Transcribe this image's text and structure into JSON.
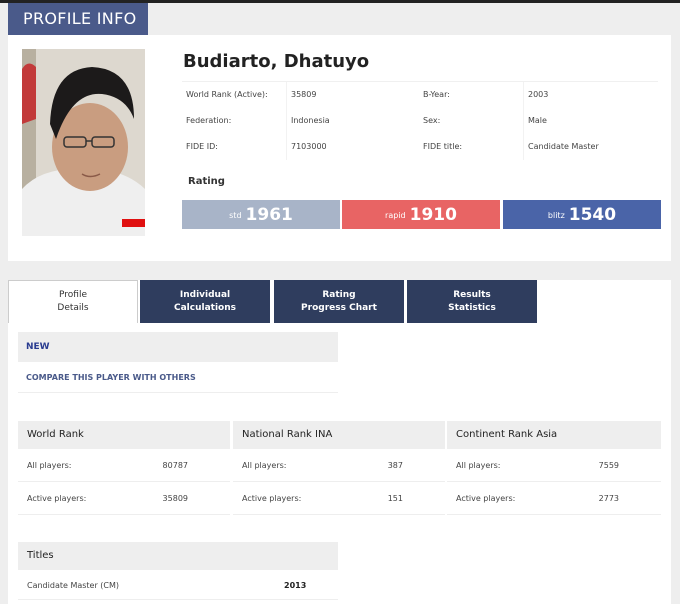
{
  "header": {
    "title": "PROFILE INFO"
  },
  "profile": {
    "name": "Budiarto, Dhatuyo",
    "fields": [
      {
        "label": "World Rank (Active):",
        "value": "35809",
        "label2": "B-Year:",
        "value2": "2003"
      },
      {
        "label": "Federation:",
        "value": "Indonesia",
        "label2": "Sex:",
        "value2": "Male"
      },
      {
        "label": "FIDE ID:",
        "value": "7103000",
        "label2": "FIDE title:",
        "value2": "Candidate Master"
      }
    ],
    "rating_label": "Rating",
    "ratings": {
      "std": {
        "type": "std",
        "value": "1961",
        "color": "#a8b4c8"
      },
      "rapid": {
        "type": "rapid",
        "value": "1910",
        "color": "#e86464"
      },
      "blitz": {
        "type": "blitz",
        "value": "1540",
        "color": "#4a64a8"
      }
    }
  },
  "tabs": [
    {
      "line1": "Profile",
      "line2": "Details"
    },
    {
      "line1": "Individual",
      "line2": "Calculations"
    },
    {
      "line1": "Rating",
      "line2": "Progress Chart"
    },
    {
      "line1": "Results",
      "line2": "Statistics"
    }
  ],
  "new_block": {
    "label": "NEW",
    "compare_link": "COMPARE THIS PLAYER WITH OTHERS"
  },
  "ranks": [
    {
      "title": "World Rank",
      "all_label": "All players:",
      "all_value": "80787",
      "active_label": "Active players:",
      "active_value": "35809"
    },
    {
      "title": "National Rank INA",
      "all_label": "All players:",
      "all_value": "387",
      "active_label": "Active players:",
      "active_value": "151"
    },
    {
      "title": "Continent Rank Asia",
      "all_label": "All players:",
      "all_value": "7559",
      "active_label": "Active players:",
      "active_value": "2773"
    }
  ],
  "titles": {
    "heading": "Titles",
    "items": [
      {
        "name": "Candidate Master (CM)",
        "year": "2013"
      }
    ]
  },
  "colors": {
    "accent": "#4a5a8a",
    "tab_dark": "#2f3d5e",
    "link": "#2a3c90"
  }
}
